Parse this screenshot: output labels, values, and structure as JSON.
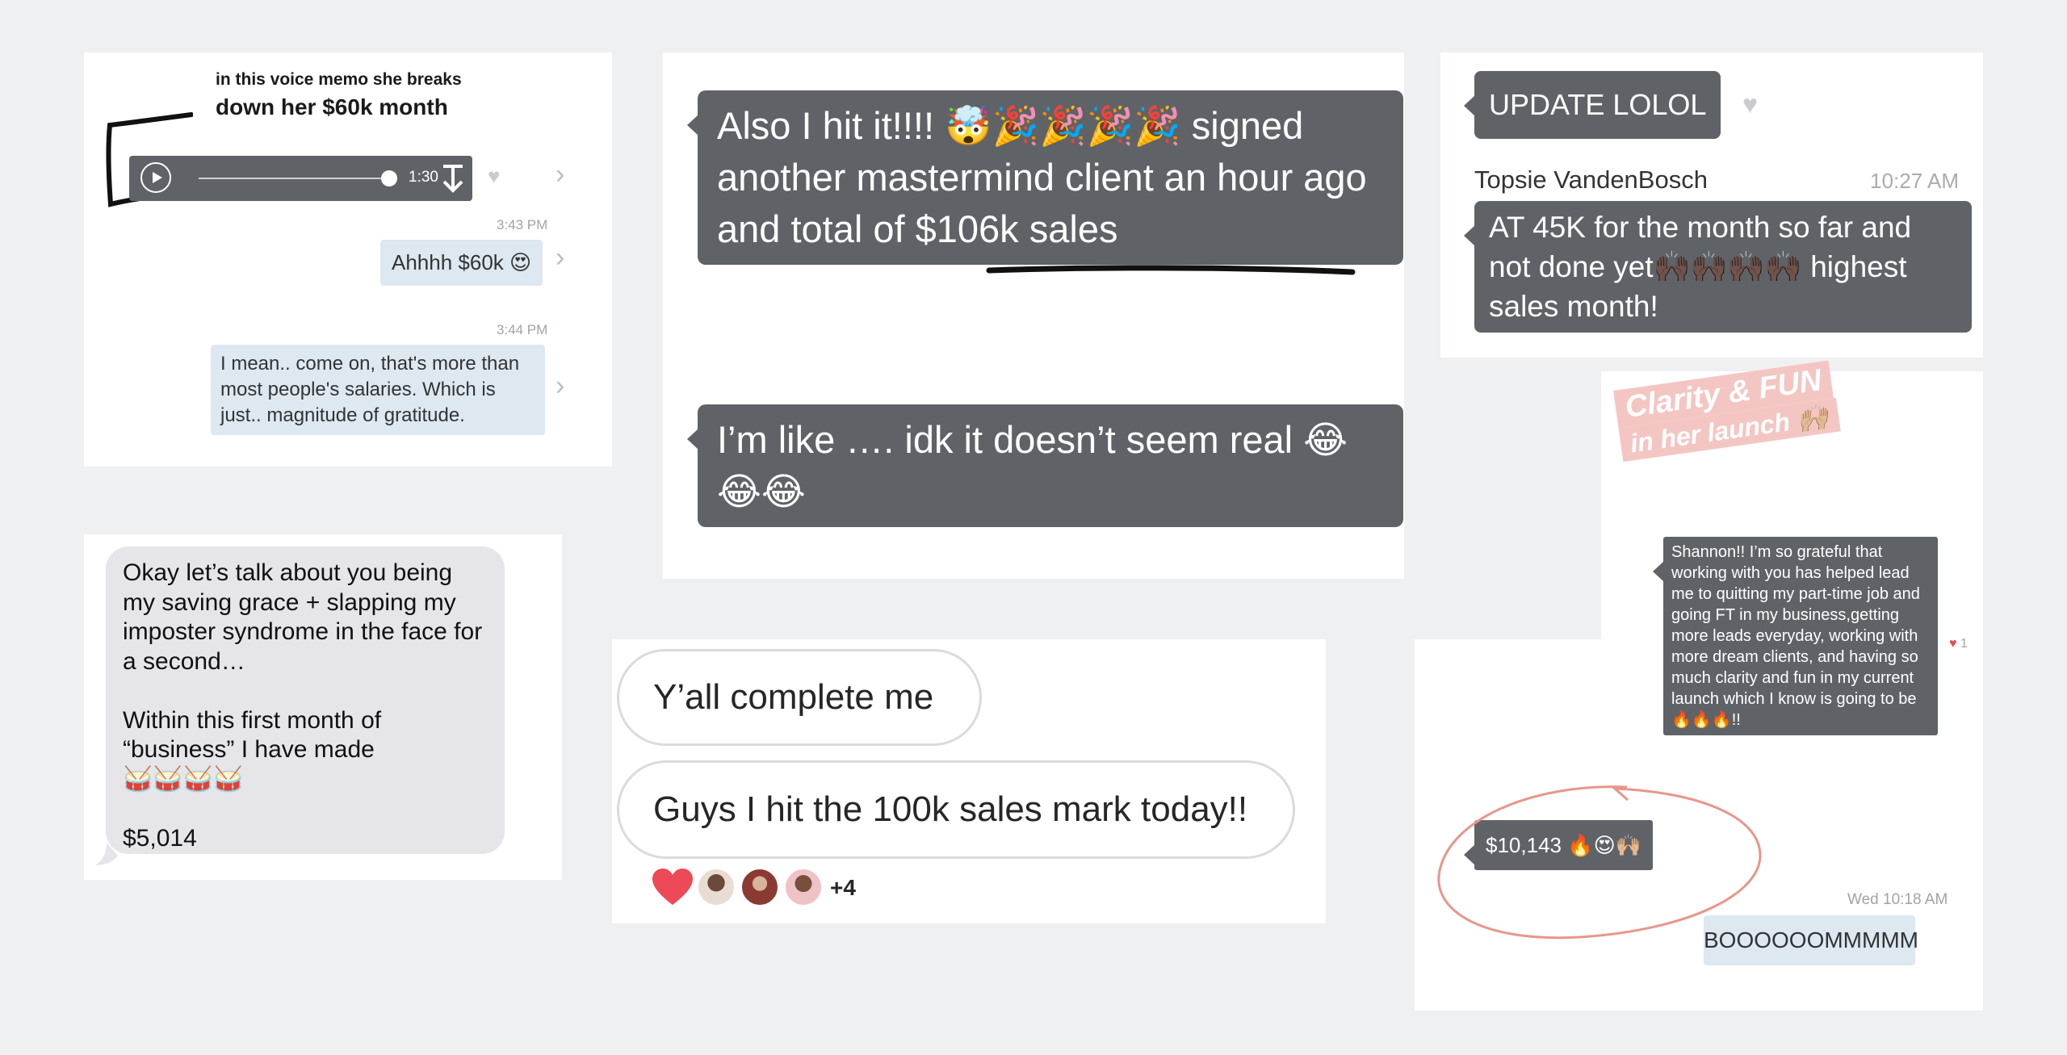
{
  "card1": {
    "caption_line1": "in this voice memo she breaks",
    "caption_line2": "down her $60k month",
    "voice_duration": "1:30",
    "time1": "3:43 PM",
    "msg1": "Ahhhh $60k 😍",
    "time2": "3:44 PM",
    "msg2": "I mean.. come on, that's more than most people's salaries. Which is just.. magnitude of gratitude."
  },
  "card2": {
    "msg1": "Also I hit it!!!! 🤯🎉🎉🎉🎉 signed another mastermind client an hour ago and total of $106k sales",
    "msg2": "I’m like …. idk it doesn’t seem real 😂😂😂"
  },
  "card3": {
    "msg1": "UPDATE LOLOL",
    "sender": "Topsie VandenBosch",
    "time": "10:27 AM",
    "msg2": "AT 45K for the month so far and not done yet🙌🏿🙌🏿🙌🏿🙌🏿 highest sales month!"
  },
  "card4": {
    "msg": "Okay let’s talk about you being my saving grace + slapping my imposter syndrome in the face for a second…\n\nWithin this first month of “business” I have made\n🥁🥁🥁🥁\n\n$5,014"
  },
  "card5": {
    "msg1": "Y’all complete me",
    "msg2": "Guys I hit the 100k sales mark today!!",
    "reactions_more": "+4"
  },
  "card6": {
    "sticker_line1": "Clarity & FUN",
    "sticker_line2": "in her launch 🙌🏼",
    "msg1": "Shannon!! I’m so grateful that working with you has helped lead me to quitting my part-time job and going FT in my business,getting more leads everyday, working with more dream clients, and having so much clarity and fun in my current launch which I know is going to be 🔥🔥🔥!!",
    "heart_count": "1",
    "msg2": "$10,143 🔥😍🙌🏼",
    "time": "Wed 10:18 AM",
    "msg3": "BOOOOOOMMMMM"
  },
  "colors": {
    "dark_bubble": "#5f6368",
    "light_bubble": "#dde8f0",
    "heart_red": "#ed4956",
    "circle_annotation": "#e8968a"
  }
}
